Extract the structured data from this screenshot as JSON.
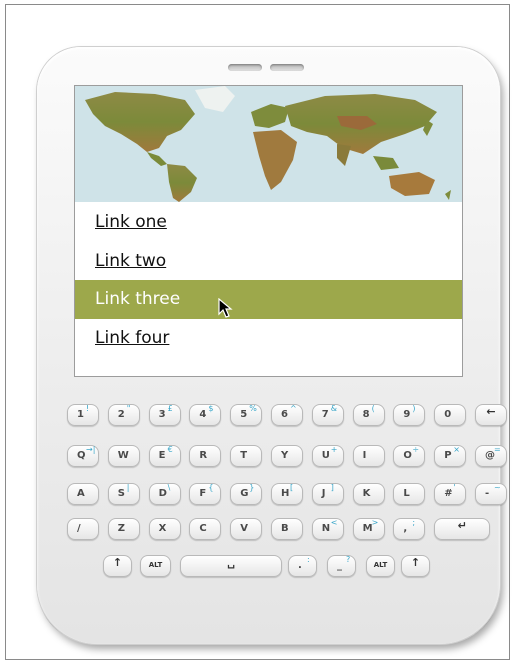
{
  "menu": {
    "items": [
      "Link one",
      "Link two",
      "Link three",
      "Link four"
    ],
    "active_index": 2
  },
  "keyboard": {
    "rows": [
      [
        {
          "m": "1",
          "s": "!"
        },
        {
          "m": "2",
          "s": "\""
        },
        {
          "m": "3",
          "s": "£"
        },
        {
          "m": "4",
          "s": "$"
        },
        {
          "m": "5",
          "s": "%"
        },
        {
          "m": "6",
          "s": "^"
        },
        {
          "m": "7",
          "s": "&"
        },
        {
          "m": "8",
          "s": "("
        },
        {
          "m": "9",
          "s": ")"
        },
        {
          "m": "0",
          "s": ""
        },
        {
          "icon": "backspace-icon"
        }
      ],
      [
        {
          "m": "Q",
          "s": "→|"
        },
        {
          "m": "W",
          "s": ""
        },
        {
          "m": "E",
          "s": "€"
        },
        {
          "m": "R",
          "s": ""
        },
        {
          "m": "T",
          "s": ""
        },
        {
          "m": "Y",
          "s": ""
        },
        {
          "m": "U",
          "s": "+"
        },
        {
          "m": "I",
          "s": ""
        },
        {
          "m": "O",
          "s": "÷"
        },
        {
          "m": "P",
          "s": "×"
        },
        {
          "m": "@",
          "s": "="
        }
      ],
      [
        {
          "m": "A",
          "s": ""
        },
        {
          "m": "S",
          "s": "|"
        },
        {
          "m": "D",
          "s": "\\"
        },
        {
          "m": "F",
          "s": "{"
        },
        {
          "m": "G",
          "s": "}"
        },
        {
          "m": "H",
          "s": "["
        },
        {
          "m": "J",
          "s": "]"
        },
        {
          "m": "K",
          "s": ""
        },
        {
          "m": "L",
          "s": ""
        },
        {
          "m": "#",
          "s": "'"
        },
        {
          "m": "-",
          "s": "~"
        }
      ],
      [
        {
          "m": "/",
          "s": ""
        },
        {
          "m": "Z",
          "s": ""
        },
        {
          "m": "X",
          "s": ""
        },
        {
          "m": "C",
          "s": ""
        },
        {
          "m": "V",
          "s": ""
        },
        {
          "m": "B",
          "s": ""
        },
        {
          "m": "N",
          "s": "<"
        },
        {
          "m": "M",
          "s": ">"
        },
        {
          "m": ",",
          "s": ";"
        },
        {
          "icon": "enter-icon"
        }
      ],
      [
        {
          "icon": "shift-icon"
        },
        {
          "label": "ALT"
        },
        {
          "icon": "space-icon"
        },
        {
          "m": ".",
          "s": ":"
        },
        {
          "m": "_",
          "s": "?"
        },
        {
          "label": "ALT"
        },
        {
          "icon": "shift-icon"
        }
      ]
    ]
  },
  "colors": {
    "active_bg": "#9da84b",
    "alt_char": "#3aa6c8"
  }
}
